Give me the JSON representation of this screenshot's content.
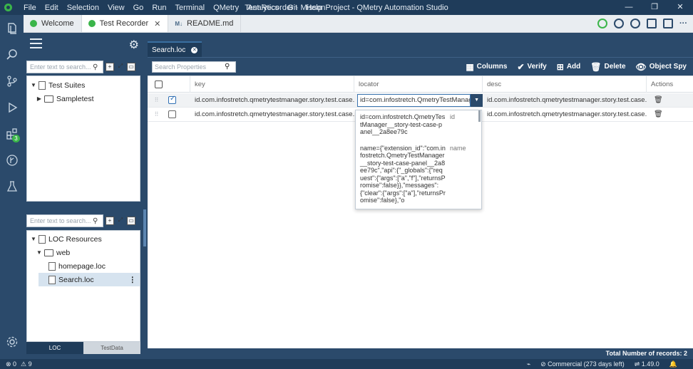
{
  "titlebar": {
    "menus": [
      "File",
      "Edit",
      "Selection",
      "View",
      "Go",
      "Run",
      "Terminal",
      "QMetry",
      "Analytics",
      "Git",
      "Help"
    ],
    "title": "Test Recorder - MissonProject - QMetry Automation Studio",
    "controls": {
      "minimize": "—",
      "restore": "❐",
      "close": "✕"
    }
  },
  "activity_bar": {
    "extensions_badge": "3"
  },
  "editor_tabs": [
    {
      "label": "Welcome"
    },
    {
      "label": "Test Recorder",
      "close": "✕"
    },
    {
      "label": "README.md",
      "prefix": "M↓"
    }
  ],
  "left_panel": {
    "top_search_placeholder": "Enter text to search...",
    "test_suites": {
      "root": "Test Suites",
      "child": "Sampletest"
    },
    "grip": "⠿⠿⠿",
    "bottom_search_placeholder": "Enter text to search...",
    "loc_resources": {
      "root": "LOC Resources",
      "folder": "web",
      "files": [
        "homepage.loc",
        "Search.loc"
      ]
    },
    "tabs": {
      "loc": "LOC",
      "testdata": "TestData"
    }
  },
  "editor": {
    "file_tab": "Search.loc",
    "search_placeholder": "Search Properties",
    "actions": {
      "columns": "Columns",
      "verify": "Verify",
      "add": "Add",
      "delete": "Delete",
      "object_spy": "Object Spy"
    },
    "columns": {
      "key": "key",
      "locator": "locator",
      "desc": "desc",
      "actions": "Actions"
    },
    "rows": [
      {
        "checked": true,
        "key": "id.com.infostretch.qmetrytestmanager.story.test.case....",
        "locator": "id=com.infostretch.QmetryTestManag",
        "desc": "id.com.infostretch.qmetrytestmanager.story.test.case...."
      },
      {
        "checked": false,
        "key": "id.com.infostretch.qmetrytestmanager.story.test.case....",
        "locator": "",
        "desc": "id.com.infostretch.qmetrytestmanager.story.test.case...."
      }
    ],
    "locator_dropdown": [
      {
        "value": "id=com.infostretch.QmetryTestManager__story-test-case-panel__2a8ee79c",
        "tag": "id"
      },
      {
        "value": "name={\"extension_id\":\"com.infostretch.QmetryTestManager__story-test-case-panel__2a8ee79c\",\"api\":{\"_globals\":{\"request\":{\"args\":[\"a\",\"f\"],\"returnsPromise\":false}},\"messages\":{\"clear\":{\"args\":[\"a\"],\"returnsPromise\":false},\"o",
        "tag": "name"
      }
    ],
    "footer": "Total Number of records: 2"
  },
  "statusbar": {
    "errors": "⊗ 0",
    "warnings": "⚠ 9",
    "license": "Commercial (273 days left)",
    "version": "1.49.0"
  }
}
